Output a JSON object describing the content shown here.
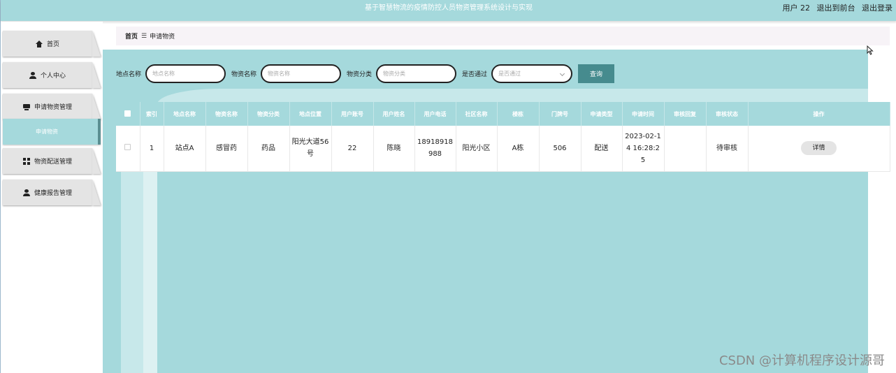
{
  "header": {
    "title": "基于智慧物流的疫情防控人员物资管理系统设计与实现",
    "user_label": "用户 22",
    "front_label": "退出到前台",
    "logout_label": "退出登录"
  },
  "sidebar": {
    "items": [
      {
        "label": "首页",
        "icon": "home-icon"
      },
      {
        "label": "个人中心",
        "icon": "user-icon"
      },
      {
        "label": "申请物资管理",
        "icon": "box-icon"
      },
      {
        "label": "物资配送管理",
        "icon": "grid-icon"
      },
      {
        "label": "健康报告管理",
        "icon": "user-icon"
      }
    ],
    "active_sub": "申请物资"
  },
  "breadcrumb": {
    "home": "首页",
    "separator": "☰",
    "current": "申请物资"
  },
  "search": {
    "site_label": "地点名称",
    "site_placeholder": "地点名称",
    "name_label": "物资名称",
    "name_placeholder": "物资名称",
    "category_label": "物资分类",
    "category_placeholder": "物资分类",
    "passed_label": "是否通过",
    "passed_placeholder": "是否通过",
    "query_button": "查询"
  },
  "table": {
    "headers": [
      "索引",
      "地点名称",
      "物资名称",
      "物资分类",
      "地点位置",
      "用户账号",
      "用户姓名",
      "用户电话",
      "社区名称",
      "楼栋",
      "门牌号",
      "申请类型",
      "申请时间",
      "审核回复",
      "审核状态",
      "操作"
    ],
    "rows": [
      {
        "index": "1",
        "site": "站点A",
        "name": "感冒药",
        "category": "药品",
        "location": "阳光大道56号",
        "account": "22",
        "username": "陈晓",
        "phone": "18918918988",
        "community": "阳光小区",
        "building": "A栋",
        "door": "506",
        "type": "配送",
        "time": "2023-02-14 16:28:25",
        "reply": "",
        "status": "待审核",
        "action": "详情"
      }
    ]
  },
  "watermark": "CSDN @计算机程序设计源哥",
  "colors": {
    "accent": "#a5d9dc",
    "button": "#468b8e",
    "active_border": "#5b8f92"
  }
}
